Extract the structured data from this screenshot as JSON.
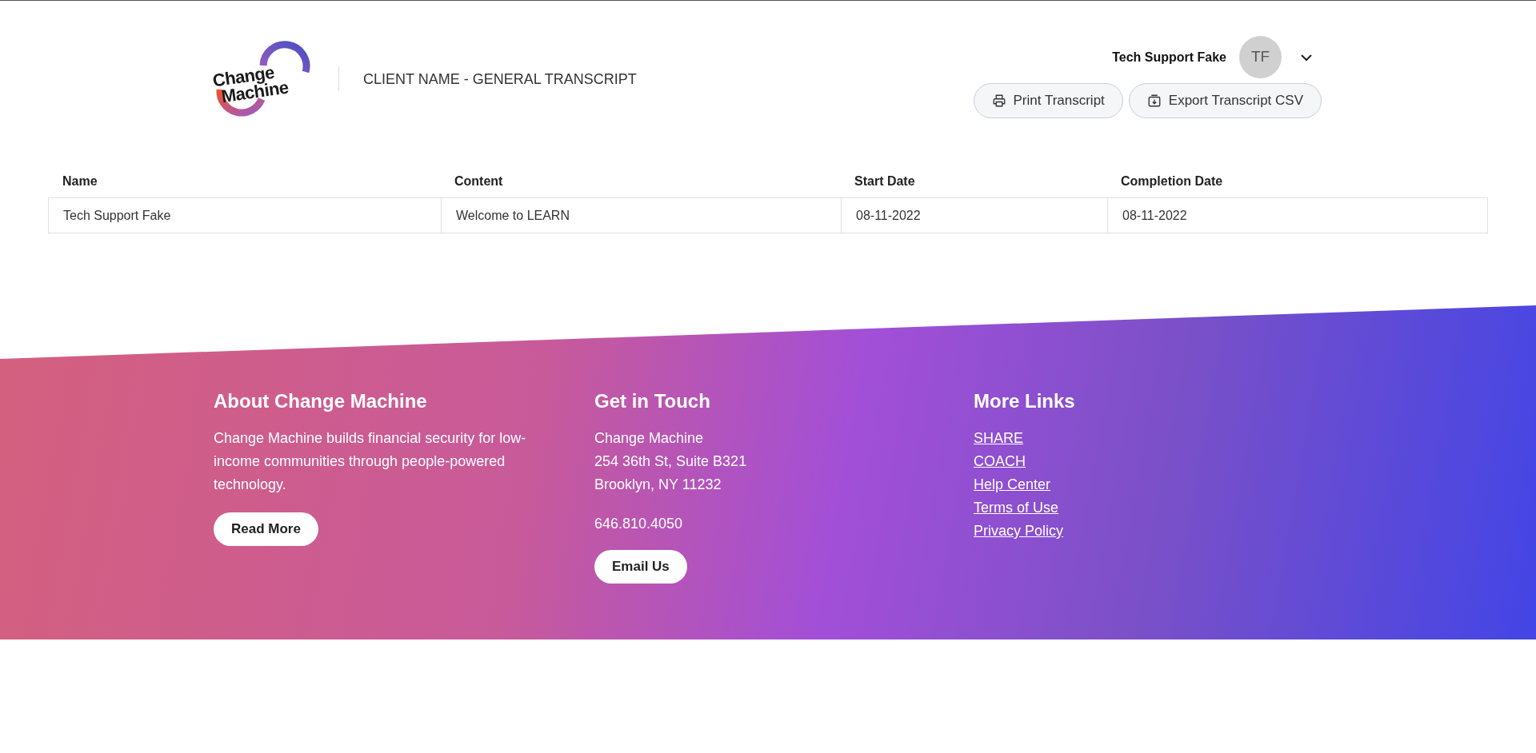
{
  "header": {
    "logo_lines": [
      "Change",
      "Machine"
    ],
    "title": "CLIENT NAME - GENERAL TRANSCRIPT",
    "user": {
      "name": "Tech Support Fake",
      "initials": "TF"
    },
    "buttons": [
      {
        "kind": "print",
        "label": "Print Transcript"
      },
      {
        "kind": "export",
        "label": "Export Transcript CSV"
      }
    ]
  },
  "table": {
    "columns": [
      "Name",
      "Content",
      "Start Date",
      "Completion Date"
    ],
    "rows": [
      [
        "Tech Support Fake",
        "Welcome to LEARN",
        "08-11-2022",
        "08-11-2022"
      ]
    ]
  },
  "footer": {
    "about": {
      "heading": "About Change Machine",
      "text": "Change Machine builds financial security for low-income communities through people-powered technology.",
      "button": "Read More"
    },
    "contact": {
      "heading": "Get in Touch",
      "address_lines": [
        "Change Machine",
        "254 36th St, Suite B321",
        "Brooklyn, NY 11232"
      ],
      "phone": "646.810.4050",
      "button": "Email Us"
    },
    "links": {
      "heading": "More Links",
      "items": [
        "SHARE",
        "COACH",
        "Help Center",
        "Terms of Use",
        "Privacy Policy"
      ]
    }
  }
}
